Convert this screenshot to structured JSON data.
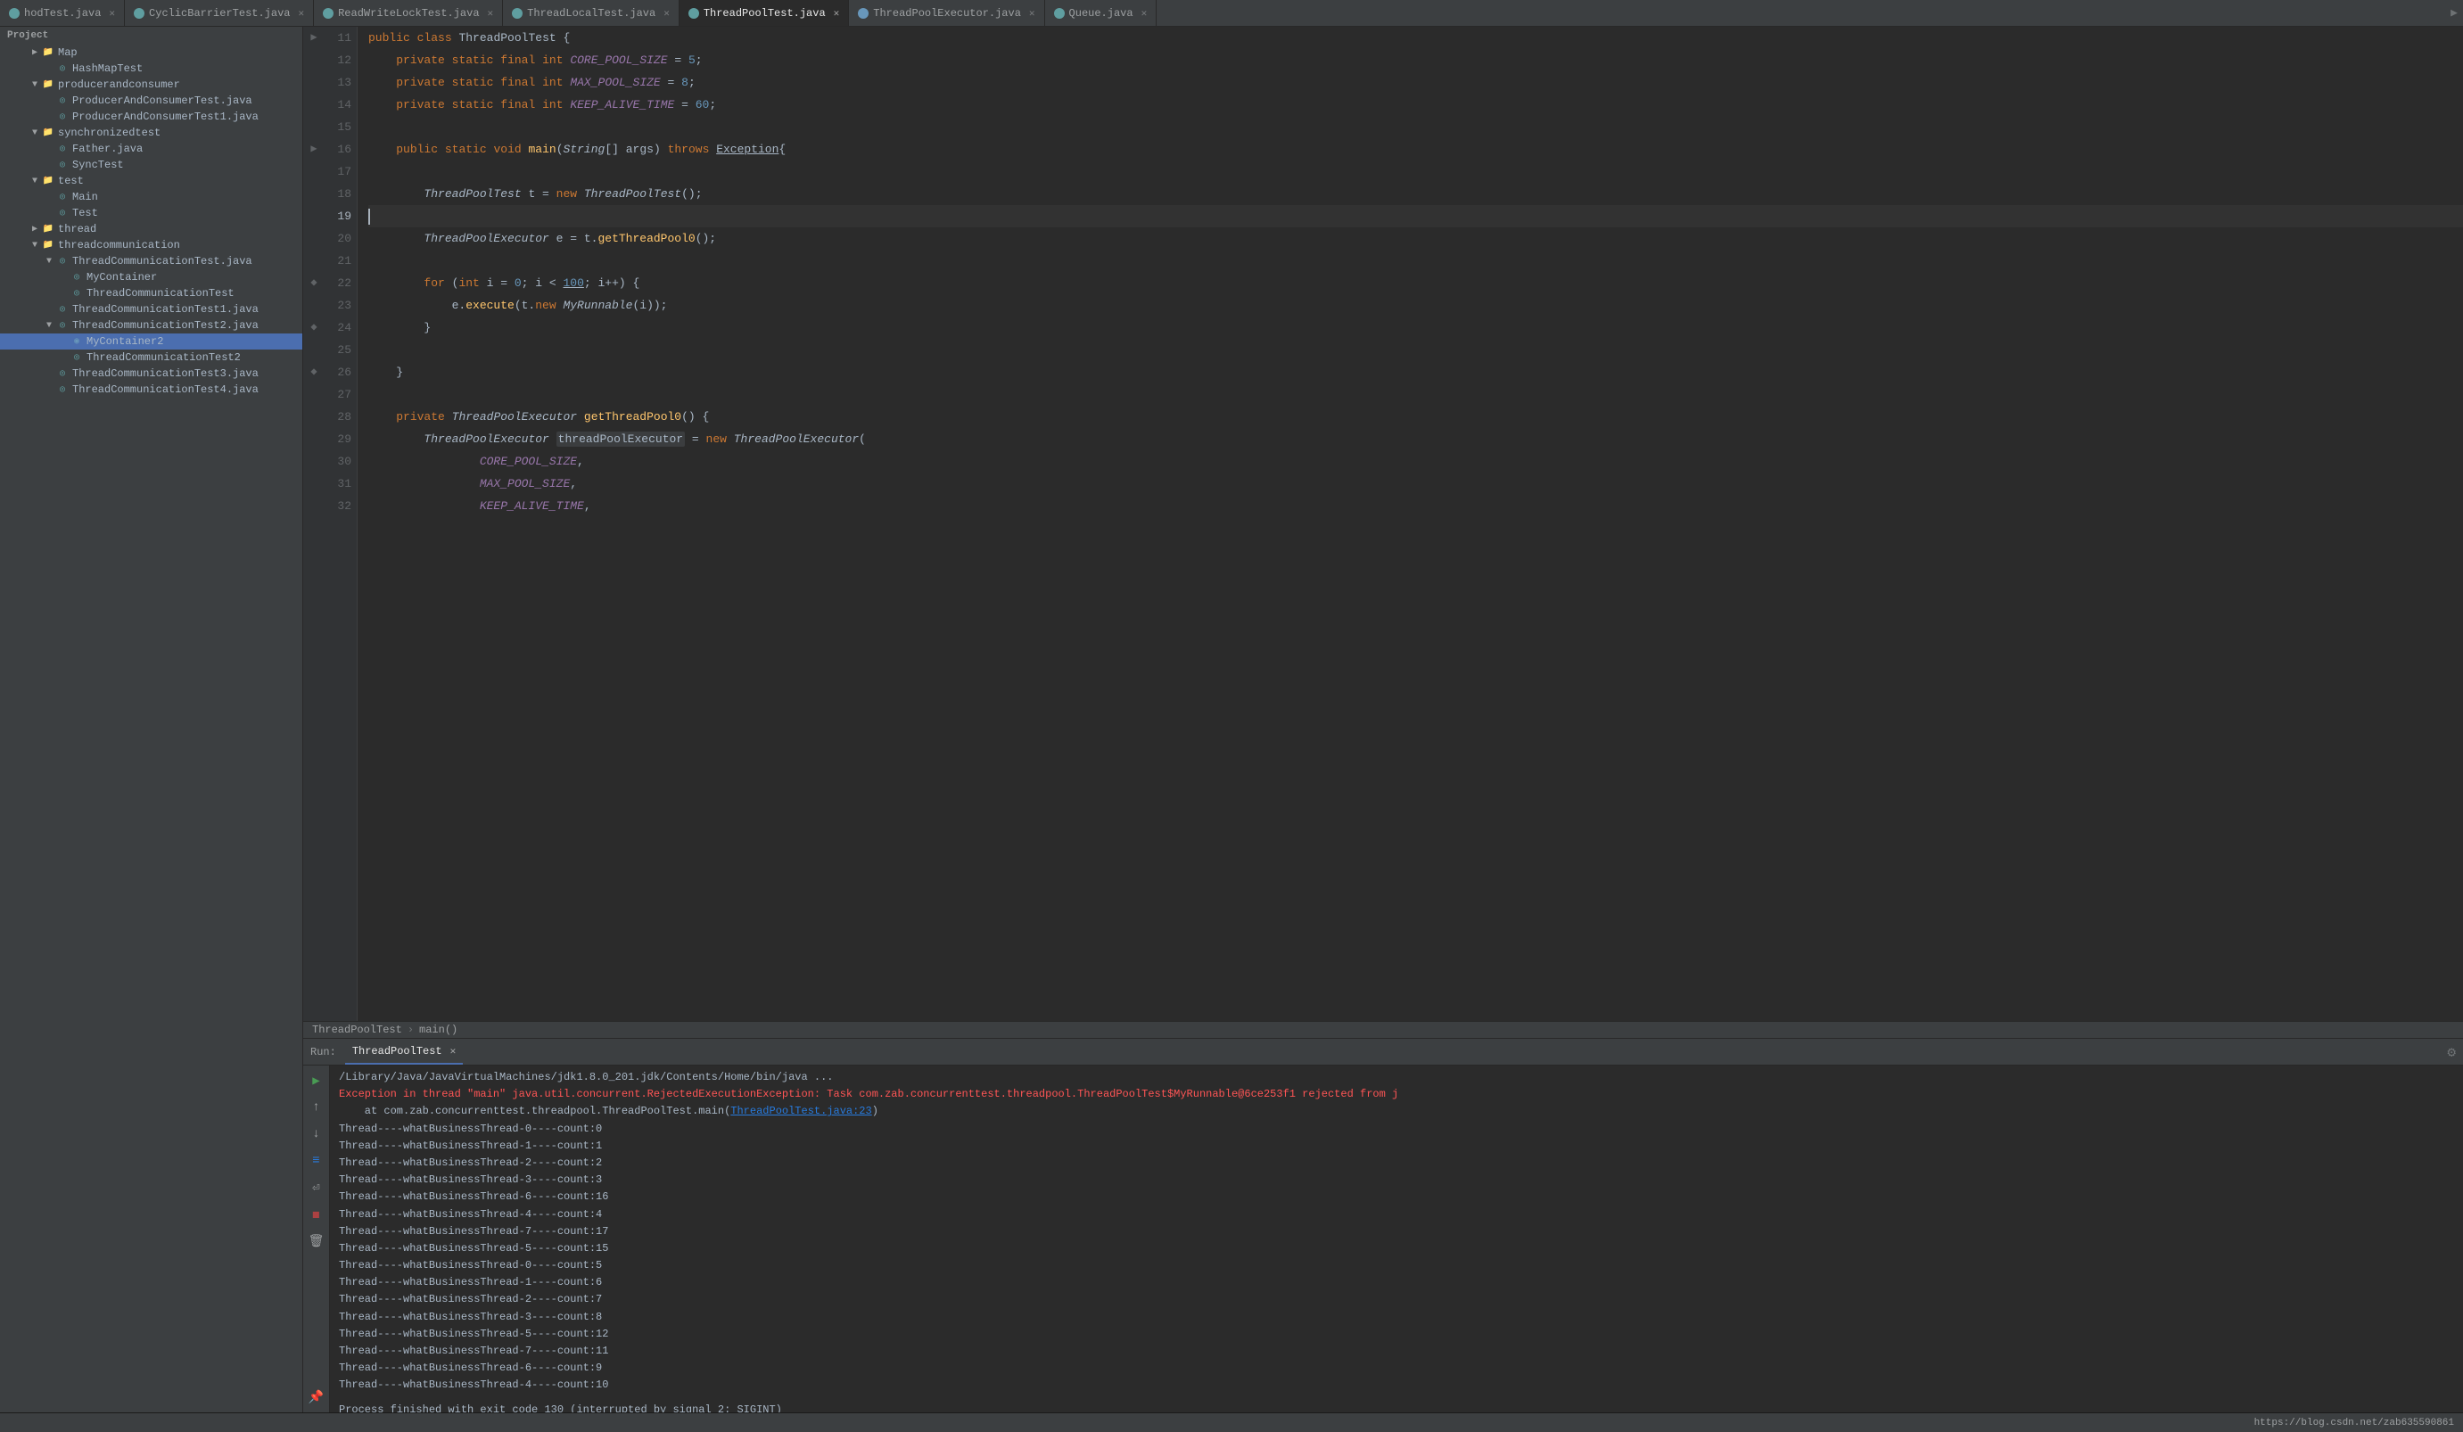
{
  "tabs": [
    {
      "label": "hodTest.java",
      "active": false,
      "color": "#5f9ea0"
    },
    {
      "label": "CyclicBarrierTest.java",
      "active": false,
      "color": "#5f9ea0"
    },
    {
      "label": "ReadWriteLockTest.java",
      "active": false,
      "color": "#5f9ea0"
    },
    {
      "label": "ThreadLocalTest.java",
      "active": false,
      "color": "#5f9ea0"
    },
    {
      "label": "ThreadPoolTest.java",
      "active": true,
      "color": "#5f9ea0"
    },
    {
      "label": "ThreadPoolExecutor.java",
      "active": false,
      "color": "#6897bb"
    },
    {
      "label": "Queue.java",
      "active": false,
      "color": "#5f9ea0"
    }
  ],
  "sidebar": {
    "items": [
      {
        "label": "Map",
        "type": "folder",
        "depth": 2,
        "expanded": true
      },
      {
        "label": "HashMapTest",
        "type": "java-green",
        "depth": 3
      },
      {
        "label": "producerandconsumer",
        "type": "folder",
        "depth": 2,
        "expanded": true
      },
      {
        "label": "ProducerAndConsumerTest.java",
        "type": "java-green",
        "depth": 3
      },
      {
        "label": "ProducerAndConsumerTest1.java",
        "type": "java-green",
        "depth": 3
      },
      {
        "label": "synchronizedtest",
        "type": "folder",
        "depth": 2,
        "expanded": true
      },
      {
        "label": "Father.java",
        "type": "java-green",
        "depth": 3
      },
      {
        "label": "SyncTest",
        "type": "java-green",
        "depth": 3
      },
      {
        "label": "test",
        "type": "folder",
        "depth": 2,
        "expanded": true
      },
      {
        "label": "Main",
        "type": "java-green",
        "depth": 3
      },
      {
        "label": "Test",
        "type": "java-green",
        "depth": 3
      },
      {
        "label": "thread",
        "type": "folder",
        "depth": 2,
        "expanded": false
      },
      {
        "label": "threadcommunication",
        "type": "folder",
        "depth": 2,
        "expanded": true
      },
      {
        "label": "ThreadCommunicationTest.java",
        "type": "java-green",
        "depth": 3
      },
      {
        "label": "MyContainer",
        "type": "java-green",
        "depth": 4
      },
      {
        "label": "ThreadCommunicationTest",
        "type": "java-green",
        "depth": 4
      },
      {
        "label": "ThreadCommunicationTest1.java",
        "type": "java-green",
        "depth": 3
      },
      {
        "label": "ThreadCommunicationTest2.java",
        "type": "java-green",
        "depth": 3,
        "expanded": true
      },
      {
        "label": "MyContainer2",
        "type": "java-blue",
        "depth": 4,
        "selected": true
      },
      {
        "label": "ThreadCommunicationTest2",
        "type": "java-green",
        "depth": 4
      },
      {
        "label": "ThreadCommunicationTest3.java",
        "type": "java-green",
        "depth": 3
      },
      {
        "label": "ThreadCommunicationTest4.java",
        "type": "java-green",
        "depth": 3
      }
    ]
  },
  "code": {
    "lines": [
      {
        "num": 11,
        "content": "public class ThreadPoolTest {",
        "type": "normal",
        "gutter": "▶"
      },
      {
        "num": 12,
        "content": "    private static final int CORE_POOL_SIZE = 5;",
        "type": "normal"
      },
      {
        "num": 13,
        "content": "    private static final int MAX_POOL_SIZE = 8;",
        "type": "normal"
      },
      {
        "num": 14,
        "content": "    private static final int KEEP_ALIVE_TIME = 60;",
        "type": "normal"
      },
      {
        "num": 15,
        "content": "",
        "type": "normal"
      },
      {
        "num": 16,
        "content": "    public static void main(String[] args) throws Exception{",
        "type": "normal",
        "gutter": "▶"
      },
      {
        "num": 17,
        "content": "",
        "type": "normal"
      },
      {
        "num": 18,
        "content": "        ThreadPoolTest t = new ThreadPoolTest();",
        "type": "normal"
      },
      {
        "num": 19,
        "content": "",
        "type": "cursor"
      },
      {
        "num": 20,
        "content": "        ThreadPoolExecutor e = t.getThreadPool0();",
        "type": "normal"
      },
      {
        "num": 21,
        "content": "",
        "type": "normal"
      },
      {
        "num": 22,
        "content": "        for (int i = 0; i < 100; i++) {",
        "type": "normal",
        "gutter": "◆"
      },
      {
        "num": 23,
        "content": "            e.execute(t.new MyRunnable(i));",
        "type": "normal"
      },
      {
        "num": 24,
        "content": "        }",
        "type": "normal",
        "gutter": "◆"
      },
      {
        "num": 25,
        "content": "",
        "type": "normal"
      },
      {
        "num": 26,
        "content": "    }",
        "type": "normal",
        "gutter": "◆"
      },
      {
        "num": 27,
        "content": "",
        "type": "normal"
      },
      {
        "num": 28,
        "content": "    private ThreadPoolExecutor getThreadPool0() {",
        "type": "normal"
      },
      {
        "num": 29,
        "content": "        ThreadPoolExecutor threadPoolExecutor = new ThreadPoolExecutor(",
        "type": "normal"
      },
      {
        "num": 30,
        "content": "                CORE_POOL_SIZE,",
        "type": "normal"
      },
      {
        "num": 31,
        "content": "                MAX_POOL_SIZE,",
        "type": "normal"
      },
      {
        "num": 32,
        "content": "                KEEP_ALIVE_TIME,",
        "type": "normal"
      }
    ]
  },
  "breadcrumb": {
    "items": [
      "ThreadPoolTest",
      "main()"
    ]
  },
  "run_panel": {
    "tab_label": "ThreadPoolTest",
    "path_line": "/Library/Java/JavaVirtualMachines/jdk1.8.0_201.jdk/Contents/Home/bin/java ...",
    "error_line": "Exception in thread \"main\" java.util.concurrent.RejectedExecutionException: Task com.zab.concurrenttest.threadpool.ThreadPoolTest$MyRunnable@6ce253f1 rejected from j",
    "stack_line": "    at com.zab.concurrenttest.threadpool.ThreadPoolTest.main(ThreadPoolTest.java:23)",
    "output_lines": [
      "Thread----whatBusinessThread-0----count:0",
      "Thread----whatBusinessThread-1----count:1",
      "Thread----whatBusinessThread-2----count:2",
      "Thread----whatBusinessThread-3----count:3",
      "Thread----whatBusinessThread-6----count:16",
      "Thread----whatBusinessThread-4----count:4",
      "Thread----whatBusinessThread-7----count:17",
      "Thread----whatBusinessThread-5----count:15",
      "Thread----whatBusinessThread-0----count:5",
      "Thread----whatBusinessThread-1----count:6",
      "Thread----whatBusinessThread-2----count:7",
      "Thread----whatBusinessThread-3----count:8",
      "Thread----whatBusinessThread-5----count:12",
      "Thread----whatBusinessThread-7----count:11",
      "Thread----whatBusinessThread-6----count:9",
      "Thread----whatBusinessThread-4----count:10"
    ],
    "process_line": "Process finished with exit code 130 (interrupted by signal 2: SIGINT)"
  },
  "status_bar": {
    "url": "https://blog.csdn.net/zab635590861"
  }
}
